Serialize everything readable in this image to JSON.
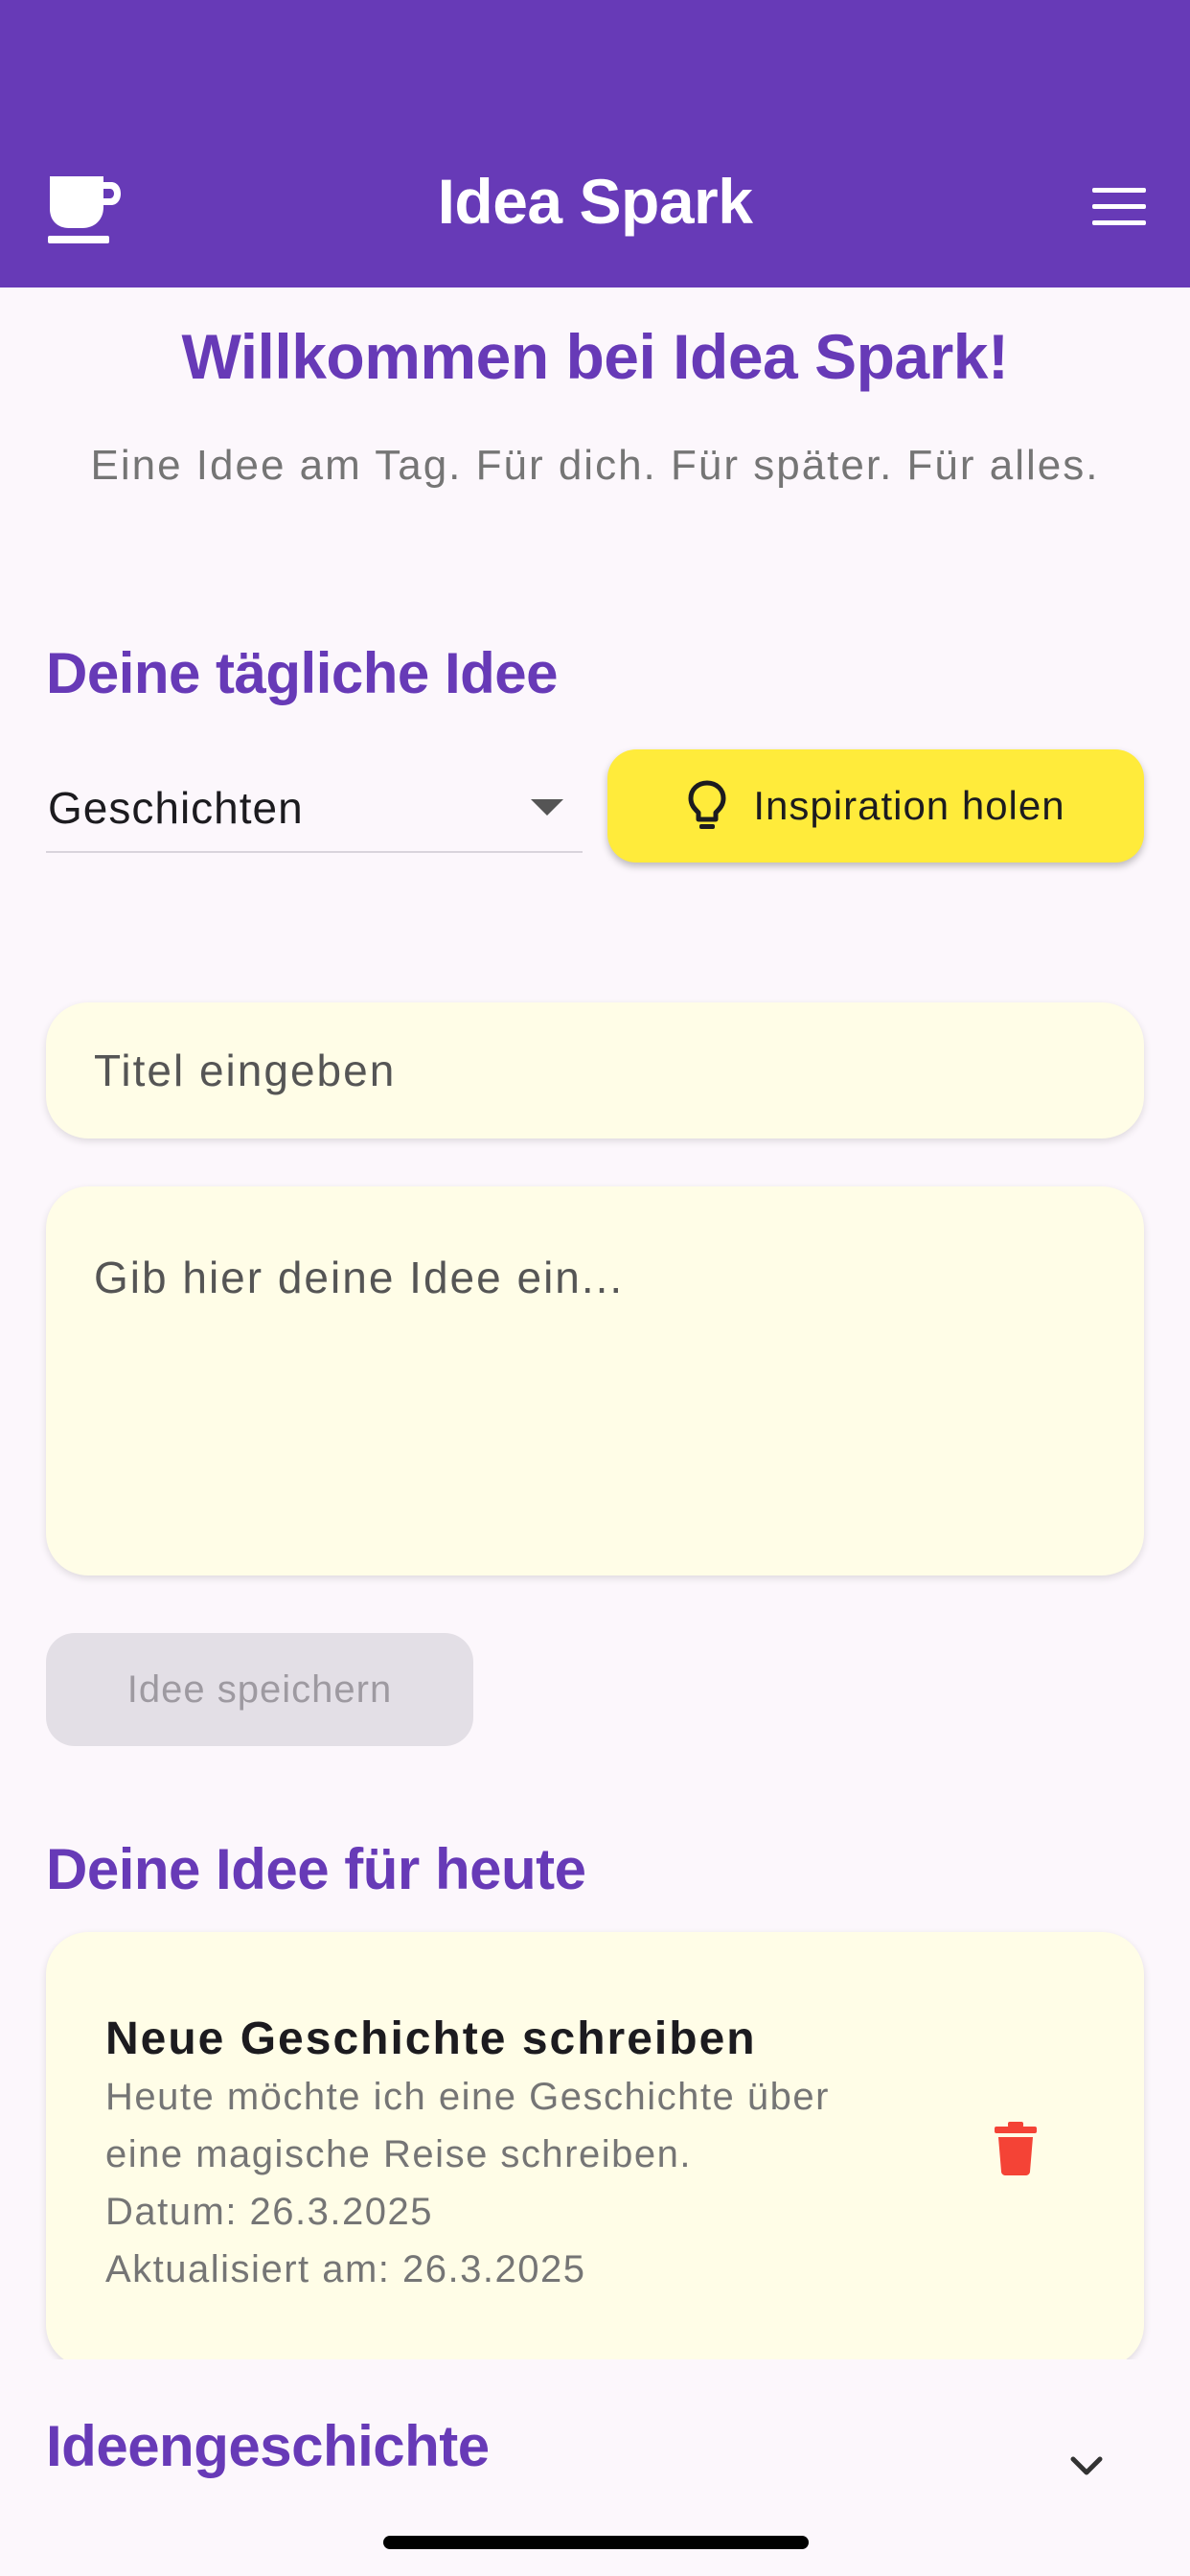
{
  "app_bar": {
    "title": "Idea Spark",
    "brand_icon": "coffee-cup-icon",
    "menu_icon": "hamburger-menu-icon",
    "color": "#673ab7"
  },
  "welcome": {
    "title": "Willkommen bei Idea Spark!",
    "subtitle": "Eine Idee am Tag. Für dich. Für später. Für alles."
  },
  "daily": {
    "section_title": "Deine tägliche Idee",
    "category_selected": "Geschichten",
    "inspire_button": "Inspiration holen",
    "inspire_icon": "lightbulb-icon",
    "inspire_color": "#ffeb3b"
  },
  "form": {
    "title_placeholder": "Titel eingeben",
    "idea_placeholder": "Gib hier deine Idee ein...",
    "save_button": "Idee speichern"
  },
  "today": {
    "section_title": "Deine Idee für heute",
    "card": {
      "title": "Neue Geschichte schreiben",
      "text_line1": "Heute möchte ich eine Geschichte über",
      "text_line2": "eine magische Reise schreiben.",
      "date": "Datum: 26.3.2025",
      "updated": "Aktualisiert am: 26.3.2025",
      "delete_icon": "trash-icon",
      "delete_color": "#f44336"
    }
  },
  "history": {
    "title": "Ideengeschichte",
    "expand_icon": "chevron-down-icon"
  }
}
